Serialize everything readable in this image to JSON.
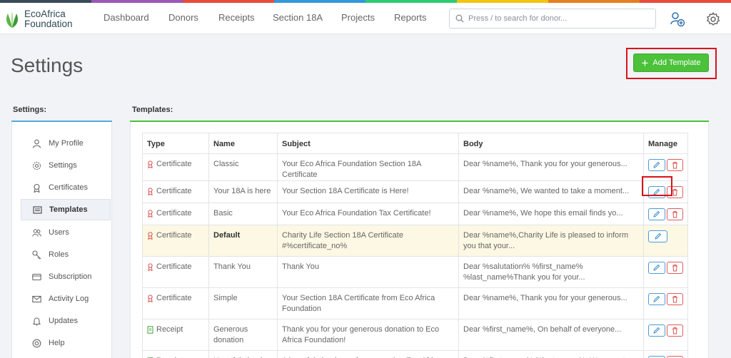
{
  "brand": {
    "line1": "EcoAfrica",
    "line2": "Foundation",
    "strip_colors": [
      "#3b4a5a",
      "#9b59b6",
      "#e74c3c",
      "#3498db",
      "#2ecc71",
      "#f1c40f",
      "#e67e22",
      "#e74c3c"
    ]
  },
  "nav": [
    "Dashboard",
    "Donors",
    "Receipts",
    "Section 18A",
    "Projects",
    "Reports"
  ],
  "search": {
    "placeholder": "Press / to search for donor..."
  },
  "page": {
    "title": "Settings",
    "add_button": "Add Template"
  },
  "sidebar": {
    "label": "Settings:",
    "items": [
      {
        "label": "My Profile",
        "icon": "user-icon"
      },
      {
        "label": "Settings",
        "icon": "gear-icon"
      },
      {
        "label": "Certificates",
        "icon": "ribbon-icon"
      },
      {
        "label": "Templates",
        "icon": "template-icon"
      },
      {
        "label": "Users",
        "icon": "users-icon"
      },
      {
        "label": "Roles",
        "icon": "key-icon"
      },
      {
        "label": "Subscription",
        "icon": "card-icon"
      },
      {
        "label": "Activity Log",
        "icon": "envelope-icon"
      },
      {
        "label": "Updates",
        "icon": "bell-icon"
      },
      {
        "label": "Help",
        "icon": "help-icon"
      }
    ]
  },
  "templates": {
    "label": "Templates:",
    "headers": [
      "Type",
      "Name",
      "Subject",
      "Body",
      "Manage"
    ],
    "rows": [
      {
        "type": "Certificate",
        "name": "Classic",
        "subject": "Your Eco Africa Foundation Section 18A Certificate",
        "body": "Dear %name%, Thank you for your generous..."
      },
      {
        "type": "Certificate",
        "name": "Your 18A is here",
        "subject": "Your Section 18A Certificate is Here!",
        "body": "Dear %name%, We wanted to take a moment..."
      },
      {
        "type": "Certificate",
        "name": "Basic",
        "subject": "Your Eco Africa Foundation Tax Certificate!",
        "body": "Dear %name%, We hope this email finds yo..."
      },
      {
        "type": "Certificate",
        "name": "Default",
        "subject": "Charity Life Section 18A Certificate #%certificate_no%",
        "body": "Dear %name%,Charity Life is pleased to inform you that your..."
      },
      {
        "type": "Certificate",
        "name": "Thank You",
        "subject": "Thank You",
        "body": "Dear %salutation% %first_name% %last_name%Thank you for your..."
      },
      {
        "type": "Certificate",
        "name": "Simple",
        "subject": "Your Section 18A Certificate from Eco Africa Foundation",
        "body": "Dear %name%, Thank you for your generous..."
      },
      {
        "type": "Receipt",
        "name": "Generous donation",
        "subject": "Thank you for your generous donation to Eco Africa Foundation!",
        "body": "Dear %first_name%, On behalf of everyone..."
      },
      {
        "type": "Receipt",
        "name": "Heartfelt thank",
        "subject": "A heartfelt thank you for supporting Eco Africa",
        "body": "Dear %first_name% %last_name%, We were t..."
      }
    ]
  }
}
